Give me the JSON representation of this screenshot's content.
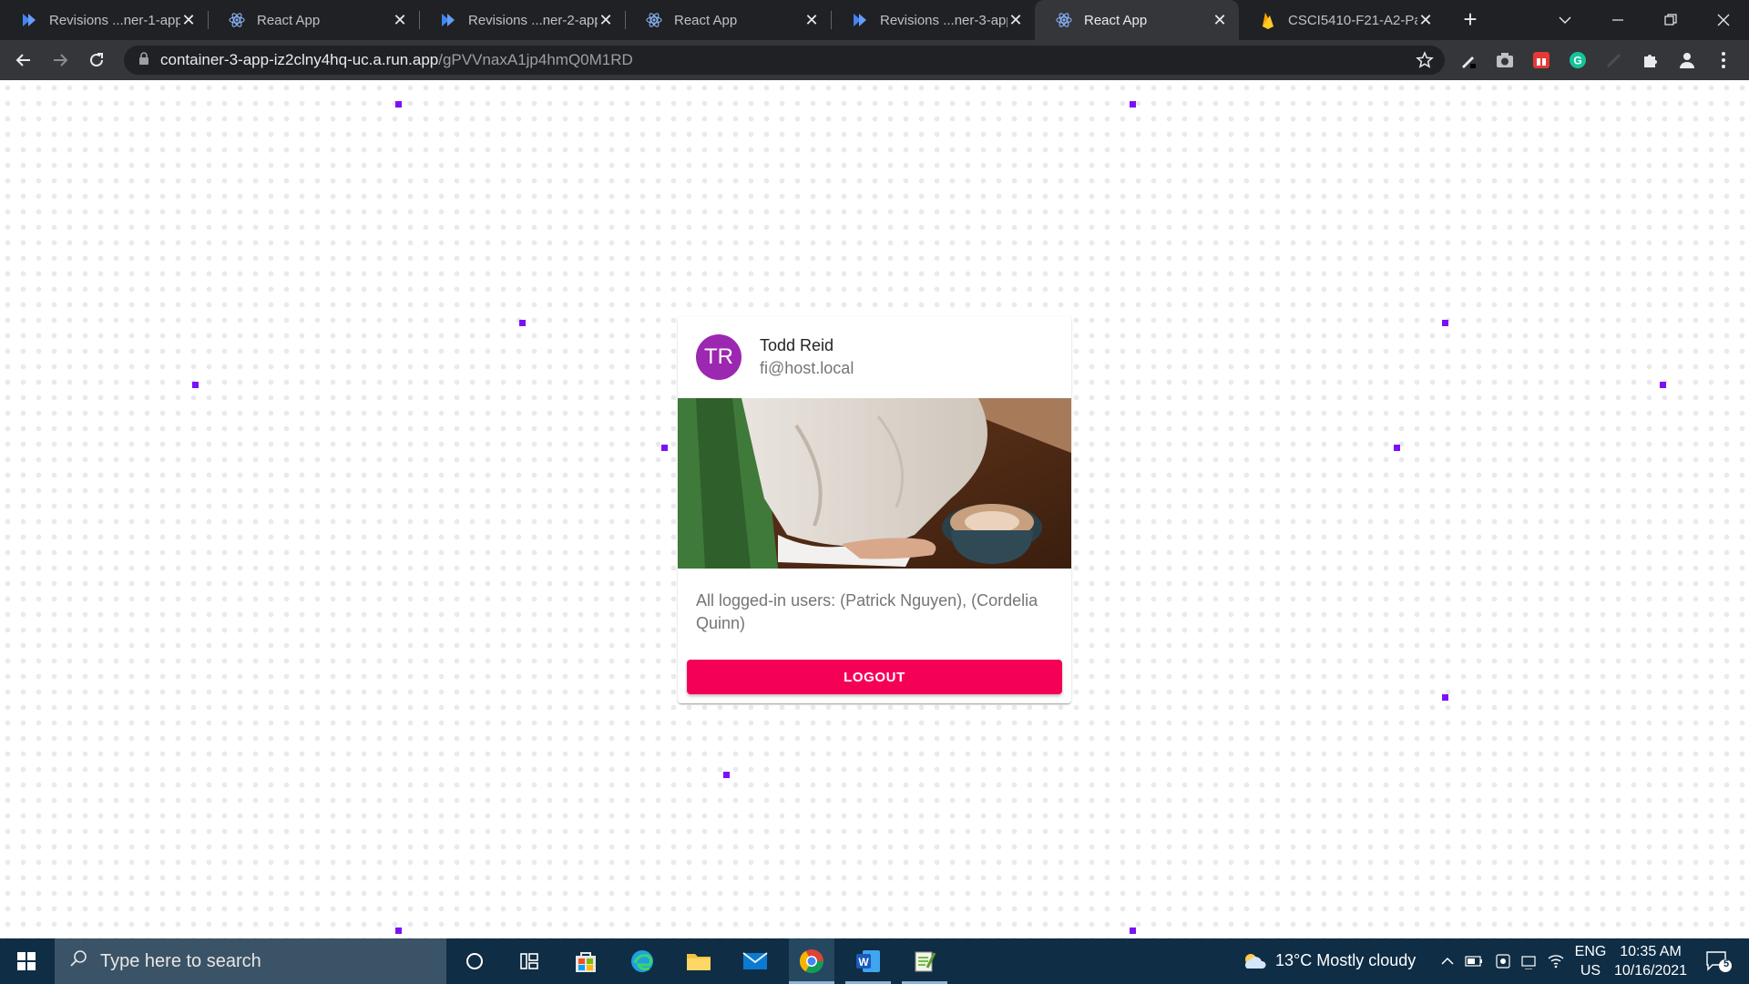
{
  "browser": {
    "tabs": [
      {
        "title": "Revisions ...ner-1-app",
        "icon": "cloud-run-icon",
        "active": false
      },
      {
        "title": "React App",
        "icon": "react-icon",
        "active": false
      },
      {
        "title": "Revisions ...ner-2-app",
        "icon": "cloud-run-icon",
        "active": false
      },
      {
        "title": "React App",
        "icon": "react-icon",
        "active": false
      },
      {
        "title": "Revisions ...ner-3-app",
        "icon": "cloud-run-icon",
        "active": false
      },
      {
        "title": "React App",
        "icon": "react-icon",
        "active": true
      },
      {
        "title": "CSCI5410-F21-A2-Par",
        "icon": "firebase-icon",
        "active": false
      }
    ],
    "address": {
      "host": "container-3-app-iz2clny4hq-uc.a.run.app",
      "path": "/gPVVnaxA1jp4hmQ0M1RD"
    }
  },
  "card": {
    "avatar_initials": "TR",
    "avatar_color": "#9c27b0",
    "name": "Todd Reid",
    "email": "fi@host.local",
    "logged_in_users": "All logged-in users: (Patrick Nguyen), (Cordelia Quinn)",
    "logout_label": "LOGOUT",
    "logout_color": "#f50057"
  },
  "taskbar": {
    "search_placeholder": "Type here to search",
    "weather": "13°C  Mostly cloudy",
    "lang": "ENG",
    "region": "US",
    "time": "10:35 AM",
    "date": "10/16/2021",
    "notifications": "5"
  },
  "colors": {
    "accent_dots": "#7a12f5",
    "taskbar": "#0f2d45",
    "chrome_dark": "#202124"
  }
}
